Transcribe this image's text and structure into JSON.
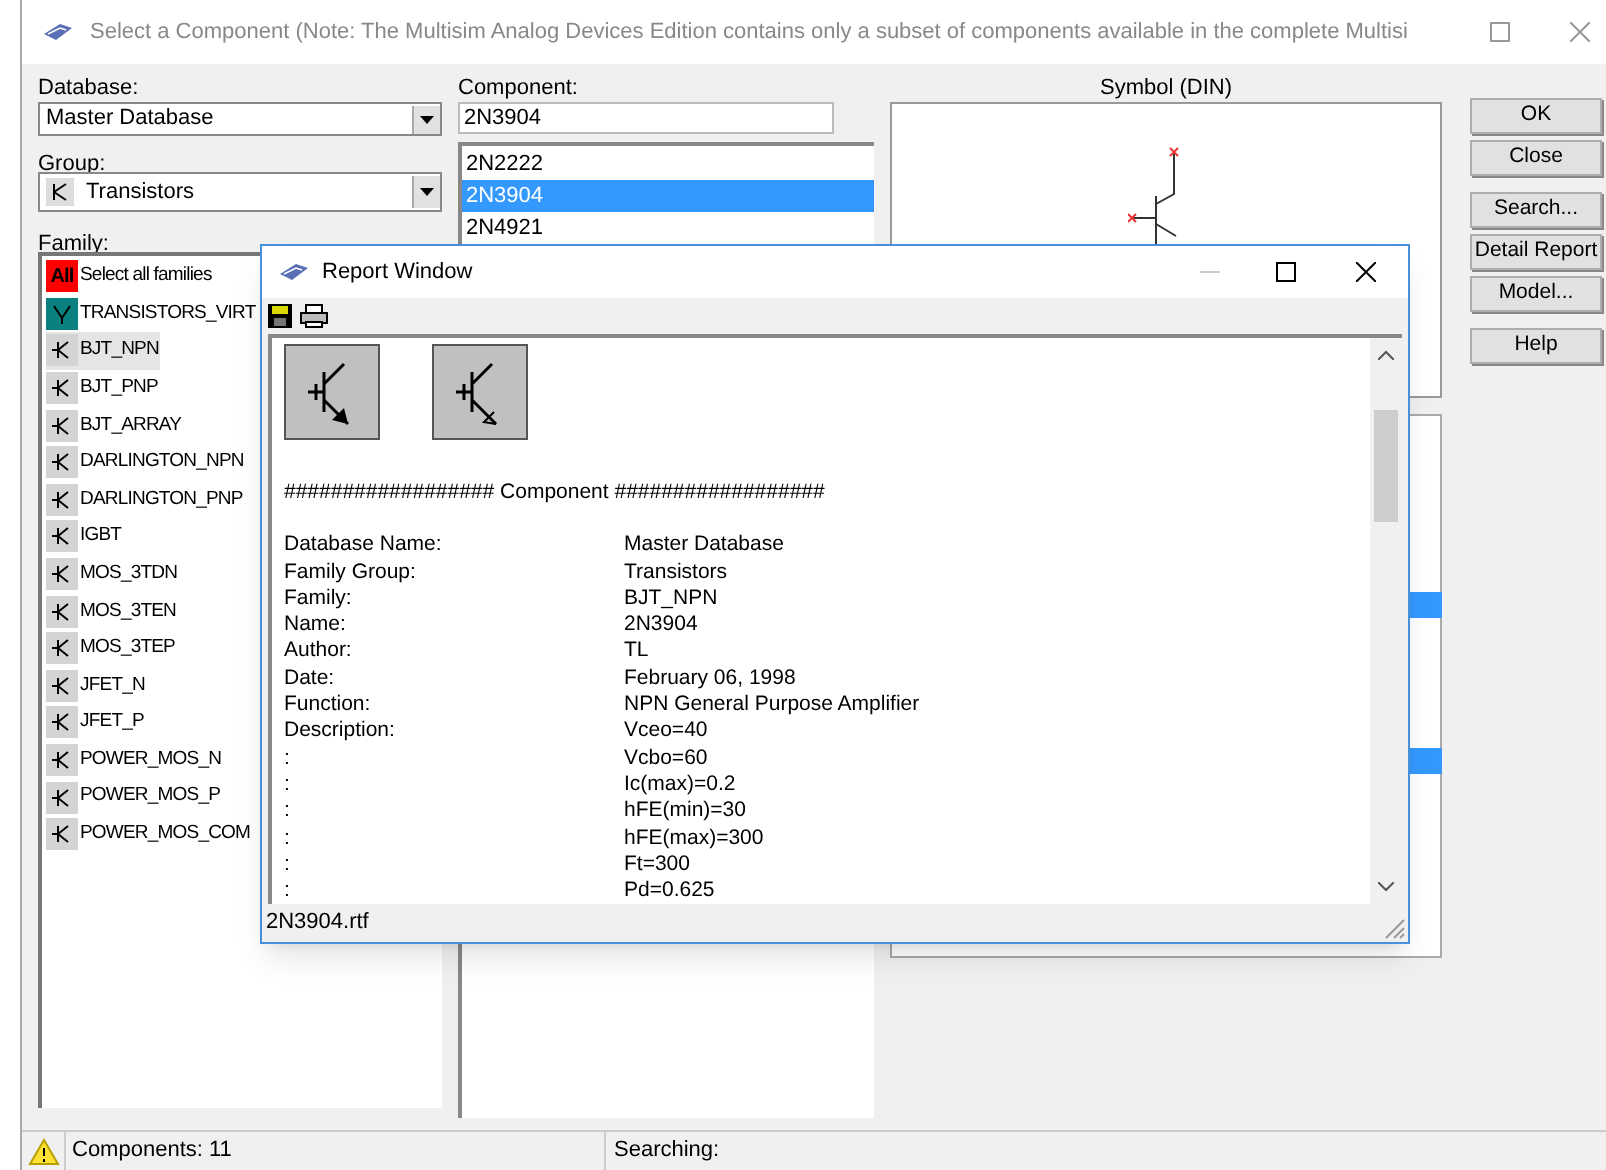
{
  "window": {
    "title": "Select a Component (Note: The Multisim Analog Devices Edition contains only a subset of components available in the complete Multisi"
  },
  "database": {
    "label": "Database:",
    "value": "Master Database"
  },
  "group": {
    "label": "Group:",
    "value": "Transistors"
  },
  "family": {
    "label": "Family:",
    "items": [
      {
        "label": "Select all families",
        "kind": "all",
        "badge": "All",
        "selected": false
      },
      {
        "label": "TRANSISTORS_VIRT",
        "kind": "virtual",
        "selected": false
      },
      {
        "label": "BJT_NPN",
        "kind": "part",
        "selected": true
      },
      {
        "label": "BJT_PNP",
        "kind": "part",
        "selected": false
      },
      {
        "label": "BJT_ARRAY",
        "kind": "part",
        "selected": false
      },
      {
        "label": "DARLINGTON_NPN",
        "kind": "part",
        "selected": false
      },
      {
        "label": "DARLINGTON_PNP",
        "kind": "part",
        "selected": false
      },
      {
        "label": "IGBT",
        "kind": "part",
        "selected": false
      },
      {
        "label": "MOS_3TDN",
        "kind": "part",
        "selected": false
      },
      {
        "label": "MOS_3TEN",
        "kind": "part",
        "selected": false
      },
      {
        "label": "MOS_3TEP",
        "kind": "part",
        "selected": false
      },
      {
        "label": "JFET_N",
        "kind": "part",
        "selected": false
      },
      {
        "label": "JFET_P",
        "kind": "part",
        "selected": false
      },
      {
        "label": "POWER_MOS_N",
        "kind": "part",
        "selected": false
      },
      {
        "label": "POWER_MOS_P",
        "kind": "part",
        "selected": false
      },
      {
        "label": "POWER_MOS_COM",
        "kind": "part",
        "selected": false
      }
    ]
  },
  "component": {
    "label": "Component:",
    "value": "2N3904",
    "items": [
      {
        "label": "2N2222",
        "selected": false
      },
      {
        "label": "2N3904",
        "selected": true
      },
      {
        "label": "2N4921",
        "selected": false
      }
    ]
  },
  "symbol": {
    "label": "Symbol (DIN)"
  },
  "buttons": [
    "OK",
    "Close",
    "Search...",
    "Detail Report",
    "Model...",
    "Help"
  ],
  "status_bar": {
    "components": "Components: 11",
    "searching": "Searching:"
  },
  "report_window": {
    "title": "Report Window",
    "heading": "################## Component ##################",
    "status": "2N3904.rtf",
    "fields": [
      {
        "label": "Database Name:",
        "value": "Master Database"
      },
      {
        "label": "Family Group:",
        "value": "Transistors"
      },
      {
        "label": "Family:",
        "value": "BJT_NPN"
      },
      {
        "label": "Name:",
        "value": "2N3904"
      },
      {
        "label": "Author:",
        "value": "TL"
      },
      {
        "label": "Date:",
        "value": "February 06, 1998"
      },
      {
        "label": "Function:",
        "value": "NPN General Purpose Amplifier"
      },
      {
        "label": "Description:",
        "value": "Vceo=40"
      },
      {
        "label": ":",
        "value": "Vcbo=60"
      },
      {
        "label": ":",
        "value": "Ic(max)=0.2"
      },
      {
        "label": ":",
        "value": "hFE(min)=30"
      },
      {
        "label": ":",
        "value": "hFE(max)=300"
      },
      {
        "label": ":",
        "value": "Ft=300"
      },
      {
        "label": ":",
        "value": "Pd=0.625"
      }
    ]
  }
}
